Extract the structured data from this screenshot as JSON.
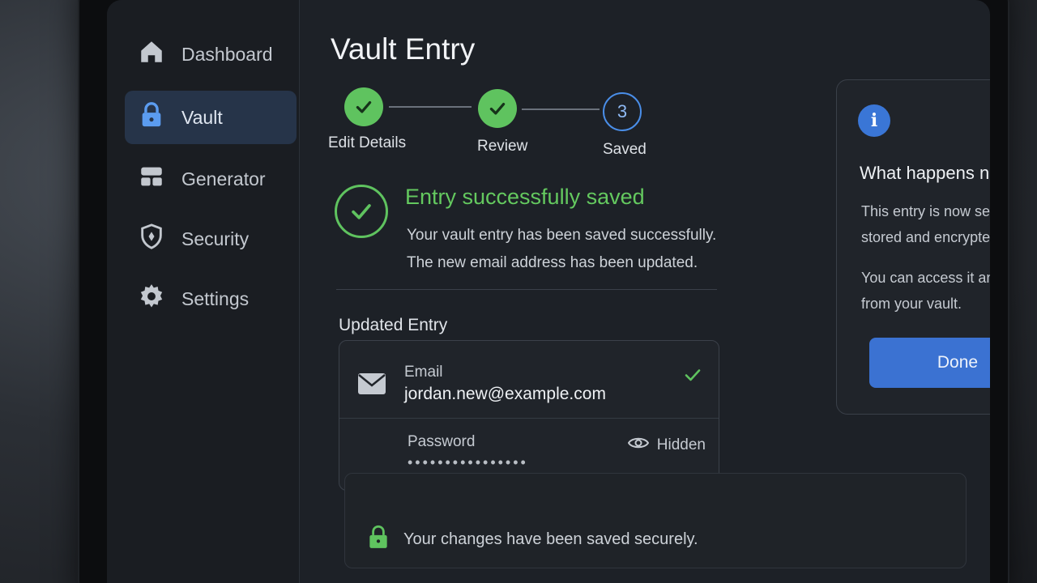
{
  "sidebar": {
    "items": [
      {
        "label": "Dashboard",
        "icon": "home-icon",
        "active": false
      },
      {
        "label": "Vault",
        "icon": "lock-icon",
        "active": true
      },
      {
        "label": "Generator",
        "icon": "generator-icon",
        "active": false
      },
      {
        "label": "Security",
        "icon": "shield-icon",
        "active": false
      },
      {
        "label": "Settings",
        "icon": "gear-icon",
        "active": false
      }
    ]
  },
  "page": {
    "title": "Vault Entry"
  },
  "stepper": {
    "steps": [
      {
        "label": "Edit Details",
        "state": "done"
      },
      {
        "label": "Review",
        "state": "done"
      },
      {
        "label": "Saved",
        "state": "current",
        "number": "3"
      }
    ]
  },
  "success": {
    "title": "Entry successfully saved",
    "line1": "Your vault entry has been saved successfully.",
    "line2": "The new email address has been updated."
  },
  "entry": {
    "section_label": "Updated Entry",
    "email_label": "Email",
    "email_value": "jordan.new@example.com",
    "password_label": "Password",
    "password_value": "••••••••••••••••",
    "visibility_label": "Hidden"
  },
  "info": {
    "heading": "What happens next",
    "text1": "This entry is now securely stored and encrypted.",
    "text2": "You can access it anytime from your vault.",
    "button_label": "Done"
  },
  "footer": {
    "message": "Your changes have been saved securely."
  },
  "colors": {
    "success": "#5fc35f",
    "accent": "#3b72d2",
    "sidebar_active": "#263449",
    "background": "#1d2127"
  }
}
